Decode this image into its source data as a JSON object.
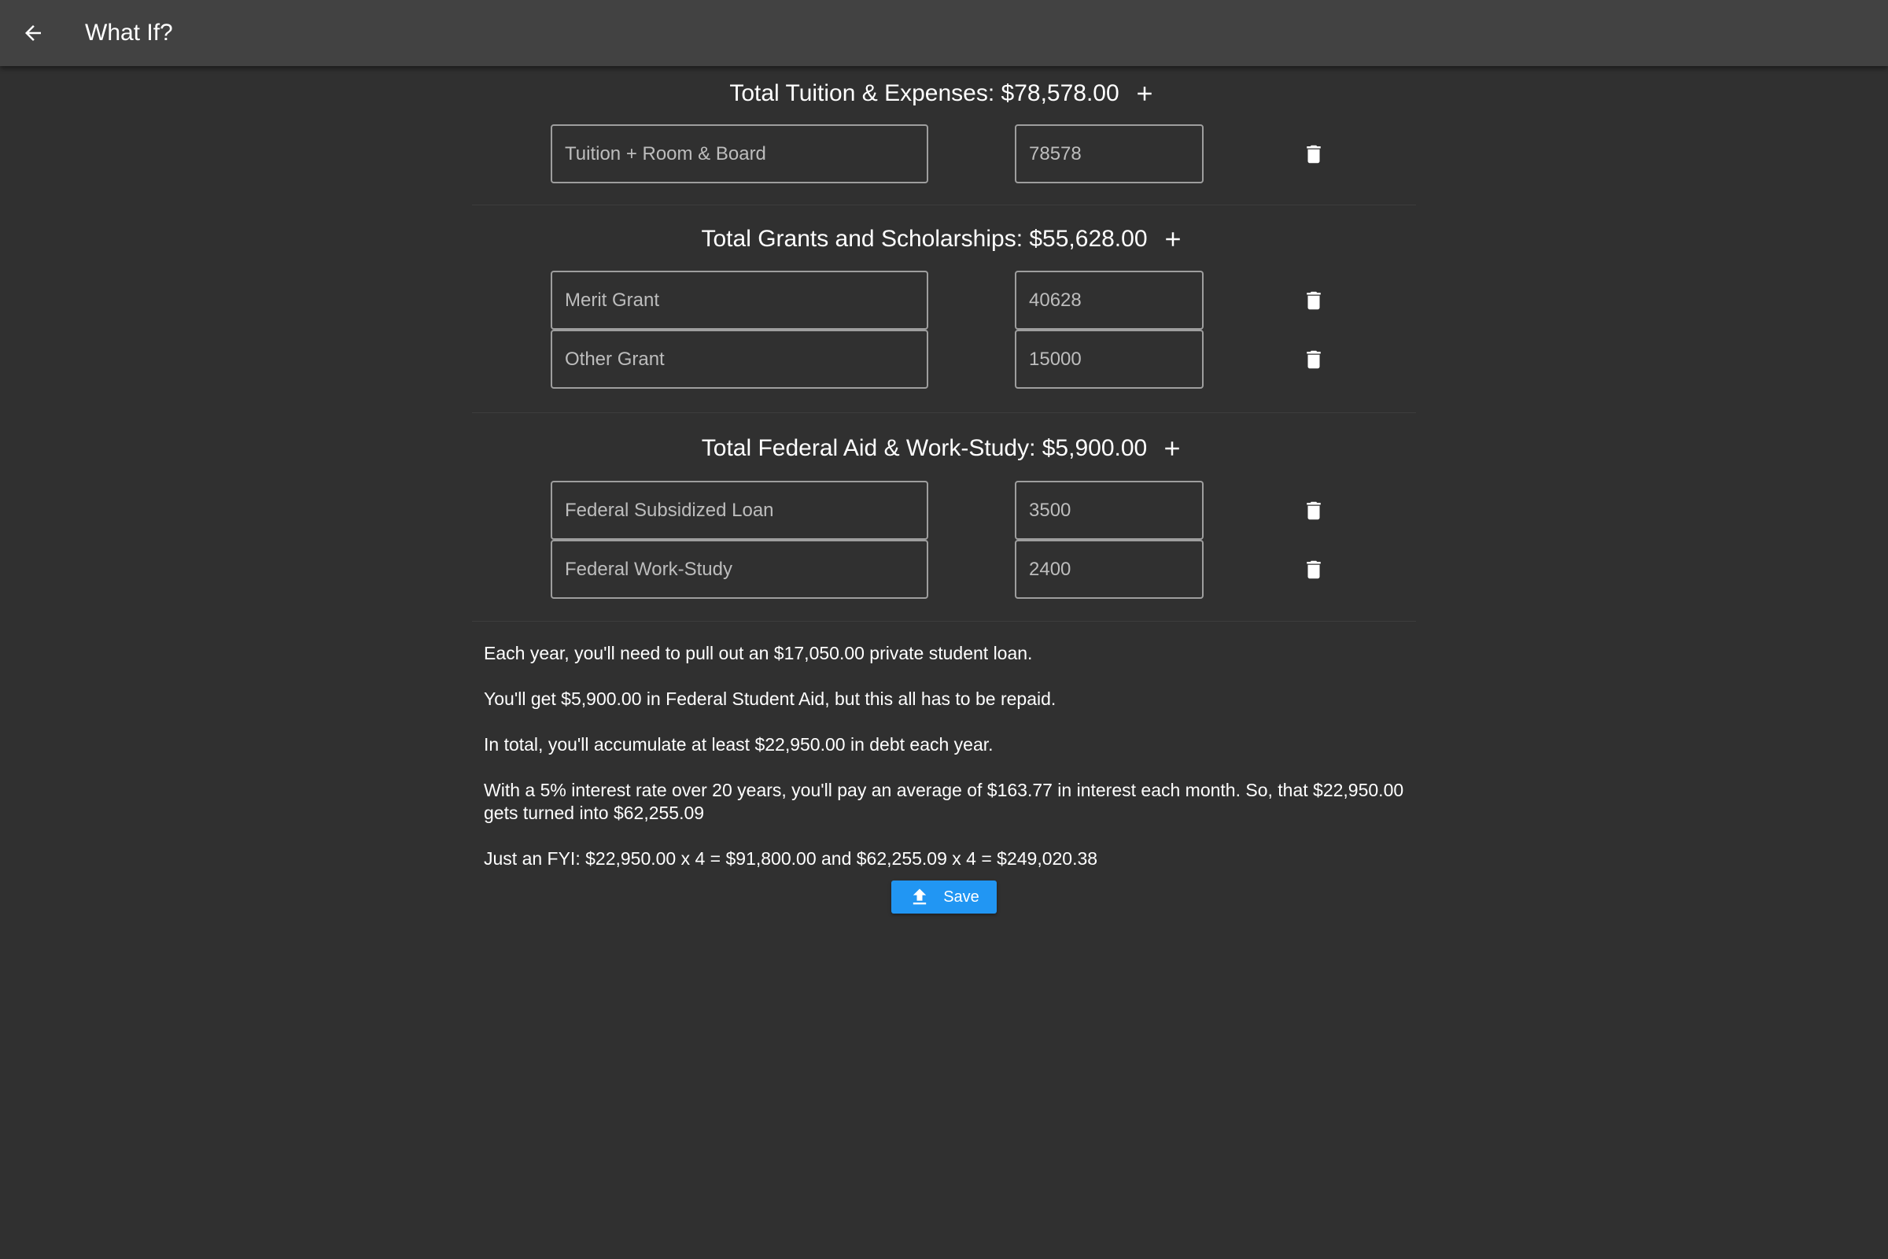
{
  "appbar": {
    "title": "What If?",
    "back_icon": "arrow-left-icon"
  },
  "sections": [
    {
      "header": "Total Tuition & Expenses: $78,578.00",
      "rows": [
        {
          "name": "Tuition + Room & Board",
          "amount": "78578"
        }
      ]
    },
    {
      "header": "Total Grants and Scholarships: $55,628.00",
      "rows": [
        {
          "name": "Merit Grant",
          "amount": "40628"
        },
        {
          "name": "Other Grant",
          "amount": "15000"
        }
      ]
    },
    {
      "header": "Total Federal Aid & Work-Study: $5,900.00",
      "rows": [
        {
          "name": "Federal Subsidized Loan",
          "amount": "3500"
        },
        {
          "name": "Federal Work-Study",
          "amount": "2400"
        }
      ]
    }
  ],
  "summary": {
    "line1": "Each year, you'll need to pull out an $17,050.00 private student loan.",
    "line2": "You'll get $5,900.00 in Federal Student Aid, but this all has to be repaid.",
    "line3": "In total, you'll accumulate at least $22,950.00 in debt each year.",
    "line4": "With a 5% interest rate over 20 years, you'll pay an average of $163.77 in interest each month. So, that $22,950.00 gets turned into $62,255.09",
    "line5": "Just an FYI: $22,950.00 x 4 = $91,800.00 and $62,255.09 x 4 = $249,020.38"
  },
  "save_button": {
    "label": "Save",
    "icon": "upload-icon"
  },
  "colors": {
    "background": "#303030",
    "appbar": "#424242",
    "accent": "#2196f3",
    "field_border": "#9e9e9e"
  }
}
